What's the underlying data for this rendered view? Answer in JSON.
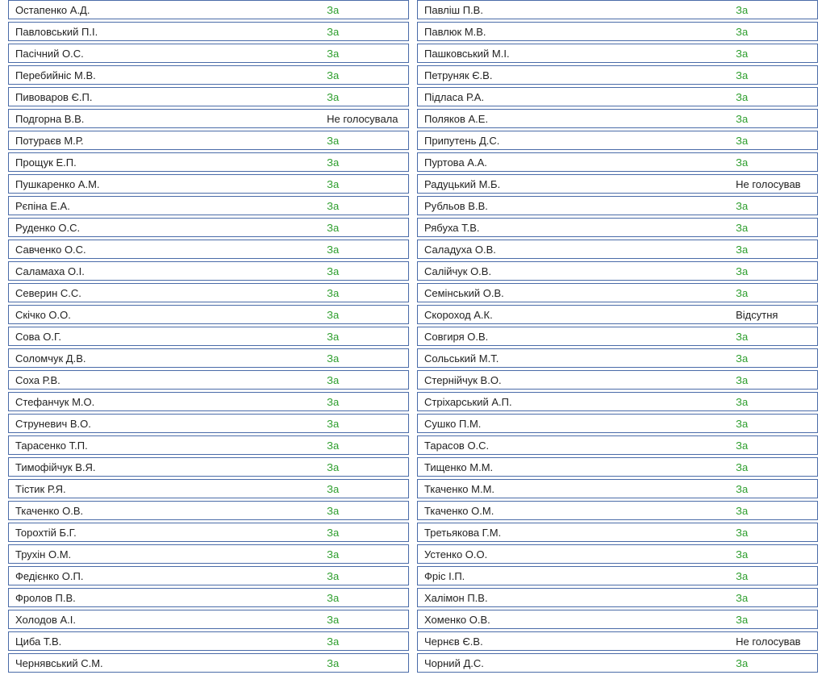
{
  "vote_labels": {
    "za": "За",
    "ne_holosuvala": "Не голосувала",
    "ne_holosuvav": "Не голосував",
    "vidsutnya": "Відсутня"
  },
  "left_column": [
    {
      "name": "Остапенко А.Д.",
      "vote": "za"
    },
    {
      "name": "Павловський П.І.",
      "vote": "za"
    },
    {
      "name": "Пасічний О.С.",
      "vote": "za"
    },
    {
      "name": "Перебийніс М.В.",
      "vote": "za"
    },
    {
      "name": "Пивоваров Є.П.",
      "vote": "za"
    },
    {
      "name": "Подгорна В.В.",
      "vote": "ne_holosuvala"
    },
    {
      "name": "Потураєв М.Р.",
      "vote": "za"
    },
    {
      "name": "Прощук Е.П.",
      "vote": "za"
    },
    {
      "name": "Пушкаренко А.М.",
      "vote": "za"
    },
    {
      "name": "Рєпіна Е.А.",
      "vote": "za"
    },
    {
      "name": "Руденко О.С.",
      "vote": "za"
    },
    {
      "name": "Савченко О.С.",
      "vote": "za"
    },
    {
      "name": "Саламаха О.І.",
      "vote": "za"
    },
    {
      "name": "Северин С.С.",
      "vote": "za"
    },
    {
      "name": "Скічко О.О.",
      "vote": "za"
    },
    {
      "name": "Сова О.Г.",
      "vote": "za"
    },
    {
      "name": "Соломчук Д.В.",
      "vote": "za"
    },
    {
      "name": "Соха Р.В.",
      "vote": "za"
    },
    {
      "name": "Стефанчук М.О.",
      "vote": "za"
    },
    {
      "name": "Струневич В.О.",
      "vote": "za"
    },
    {
      "name": "Тарасенко Т.П.",
      "vote": "za"
    },
    {
      "name": "Тимофійчук В.Я.",
      "vote": "za"
    },
    {
      "name": "Тістик Р.Я.",
      "vote": "za"
    },
    {
      "name": "Ткаченко О.В.",
      "vote": "za"
    },
    {
      "name": "Торохтій Б.Г.",
      "vote": "za"
    },
    {
      "name": "Трухін О.М.",
      "vote": "za"
    },
    {
      "name": "Федієнко О.П.",
      "vote": "za"
    },
    {
      "name": "Фролов П.В.",
      "vote": "za"
    },
    {
      "name": "Холодов А.І.",
      "vote": "za"
    },
    {
      "name": "Циба Т.В.",
      "vote": "za"
    },
    {
      "name": "Чернявський С.М.",
      "vote": "za"
    }
  ],
  "right_column": [
    {
      "name": "Павліш П.В.",
      "vote": "za"
    },
    {
      "name": "Павлюк М.В.",
      "vote": "za"
    },
    {
      "name": "Пашковський М.І.",
      "vote": "za"
    },
    {
      "name": "Петруняк Є.В.",
      "vote": "za"
    },
    {
      "name": "Підласа Р.А.",
      "vote": "za"
    },
    {
      "name": "Поляков А.Е.",
      "vote": "za"
    },
    {
      "name": "Припутень Д.С.",
      "vote": "za"
    },
    {
      "name": "Пуртова А.А.",
      "vote": "za"
    },
    {
      "name": "Радуцький М.Б.",
      "vote": "ne_holosuvav"
    },
    {
      "name": "Рубльов В.В.",
      "vote": "za"
    },
    {
      "name": "Рябуха Т.В.",
      "vote": "za"
    },
    {
      "name": "Саладуха О.В.",
      "vote": "za"
    },
    {
      "name": "Салійчук О.В.",
      "vote": "za"
    },
    {
      "name": "Семінський О.В.",
      "vote": "za"
    },
    {
      "name": "Скороход А.К.",
      "vote": "vidsutnya"
    },
    {
      "name": "Совгиря О.В.",
      "vote": "za"
    },
    {
      "name": "Сольський М.Т.",
      "vote": "za"
    },
    {
      "name": "Стернійчук В.О.",
      "vote": "za"
    },
    {
      "name": "Стріхарський А.П.",
      "vote": "za"
    },
    {
      "name": "Сушко П.М.",
      "vote": "za"
    },
    {
      "name": "Тарасов О.С.",
      "vote": "za"
    },
    {
      "name": "Тищенко М.М.",
      "vote": "za"
    },
    {
      "name": "Ткаченко М.М.",
      "vote": "za"
    },
    {
      "name": "Ткаченко О.М.",
      "vote": "za"
    },
    {
      "name": "Третьякова Г.М.",
      "vote": "za"
    },
    {
      "name": "Устенко О.О.",
      "vote": "za"
    },
    {
      "name": "Фріс І.П.",
      "vote": "za"
    },
    {
      "name": "Халімон П.В.",
      "vote": "za"
    },
    {
      "name": "Хоменко О.В.",
      "vote": "za"
    },
    {
      "name": "Чернєв Є.В.",
      "vote": "ne_holosuvav"
    },
    {
      "name": "Чорний Д.С.",
      "vote": "za"
    }
  ]
}
